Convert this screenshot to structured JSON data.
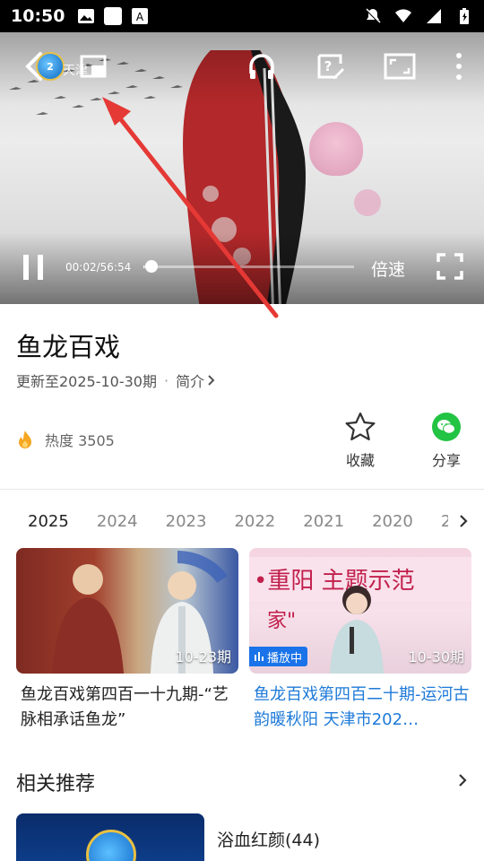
{
  "status_bar": {
    "time": "10:50"
  },
  "player": {
    "channel_badge": "2",
    "channel_text": "天津",
    "time_readout": "00:02/56:54",
    "progress_fraction": 0.001,
    "speed_label": "倍速"
  },
  "show": {
    "title": "鱼龙百戏",
    "update_text": "更新至2025-10-30期",
    "separator": "·",
    "intro_label": "简介",
    "heat_label": "热度 3505"
  },
  "actions": {
    "favorite_label": "收藏",
    "share_label": "分享"
  },
  "years": [
    "2025",
    "2024",
    "2023",
    "2022",
    "2021",
    "2020",
    "2"
  ],
  "episodes": [
    {
      "date": "10-23期",
      "title": "鱼龙百戏第四百一十九期-“艺脉相承话鱼龙”"
    },
    {
      "date": "10-30期",
      "badge": "播放中",
      "title": "鱼龙百戏第四百二十期-运河古韵暖秋阳 天津市202…"
    }
  ],
  "related": {
    "heading": "相关推荐",
    "first_item_title": "浴血红颜(44)"
  },
  "colors": {
    "accent_blue": "#1e7ad8",
    "badge_blue": "#1a73e8",
    "wechat_green": "#23c343",
    "arrow_red": "#e53935"
  }
}
